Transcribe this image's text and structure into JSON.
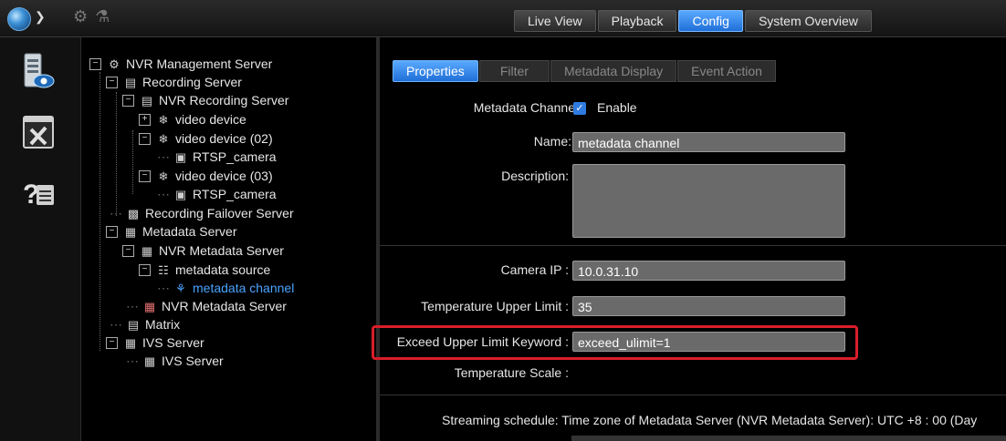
{
  "topbar": {
    "tabs": [
      {
        "label": "Live View"
      },
      {
        "label": "Playback"
      },
      {
        "label": "Config"
      },
      {
        "label": "System Overview"
      }
    ],
    "active_tab": "Config"
  },
  "tree": {
    "nodes": [
      {
        "label": "NVR Management Server",
        "icon": "management-server-icon"
      },
      {
        "label": "Recording Server",
        "icon": "server-icon"
      },
      {
        "label": "NVR Recording Server",
        "icon": "server-icon"
      },
      {
        "label": "video device",
        "icon": "video-device-icon"
      },
      {
        "label": "video device (02)",
        "icon": "video-device-icon"
      },
      {
        "label": "RTSP_camera",
        "icon": "camera-icon"
      },
      {
        "label": "video device (03)",
        "icon": "video-device-icon"
      },
      {
        "label": "RTSP_camera",
        "icon": "camera-icon"
      },
      {
        "label": "Recording Failover Server",
        "icon": "failover-icon"
      },
      {
        "label": "Metadata Server",
        "icon": "metadata-server-icon"
      },
      {
        "label": "NVR Metadata Server",
        "icon": "metadata-server-icon"
      },
      {
        "label": "metadata source",
        "icon": "metadata-source-icon"
      },
      {
        "label": "metadata channel",
        "icon": "metadata-channel-icon"
      },
      {
        "label": "NVR Metadata Server",
        "icon": "metadata-server-icon"
      },
      {
        "label": "Matrix",
        "icon": "matrix-icon"
      },
      {
        "label": "IVS Server",
        "icon": "ivs-server-icon"
      },
      {
        "label": "IVS Server",
        "icon": "ivs-server-icon"
      }
    ]
  },
  "subtabs": [
    {
      "label": "Properties"
    },
    {
      "label": "Filter"
    },
    {
      "label": "Metadata Display"
    },
    {
      "label": "Event Action"
    }
  ],
  "form": {
    "metadata_channel_label": "Metadata Channel:",
    "enable_label": "Enable",
    "enable_checked": true,
    "name_label": "Name:",
    "name_value": "metadata channel",
    "description_label": "Description:",
    "description_value": "",
    "camera_ip_label": "Camera IP :",
    "camera_ip_value": "10.0.31.10",
    "temp_upper_label": "Temperature Upper Limit :",
    "temp_upper_value": "35",
    "exceed_label": "Exceed Upper Limit Keyword :",
    "exceed_value": "exceed_ulimit=1",
    "temp_scale_label": "Temperature Scale :",
    "schedule_text": "Streaming schedule: Time zone of Metadata Server (NVR Metadata Server): UTC +8 : 00  (Day"
  },
  "colors": {
    "accent": "#2f7be0",
    "highlight_border": "#d91e2a",
    "selected_text": "#4aa3ff"
  }
}
